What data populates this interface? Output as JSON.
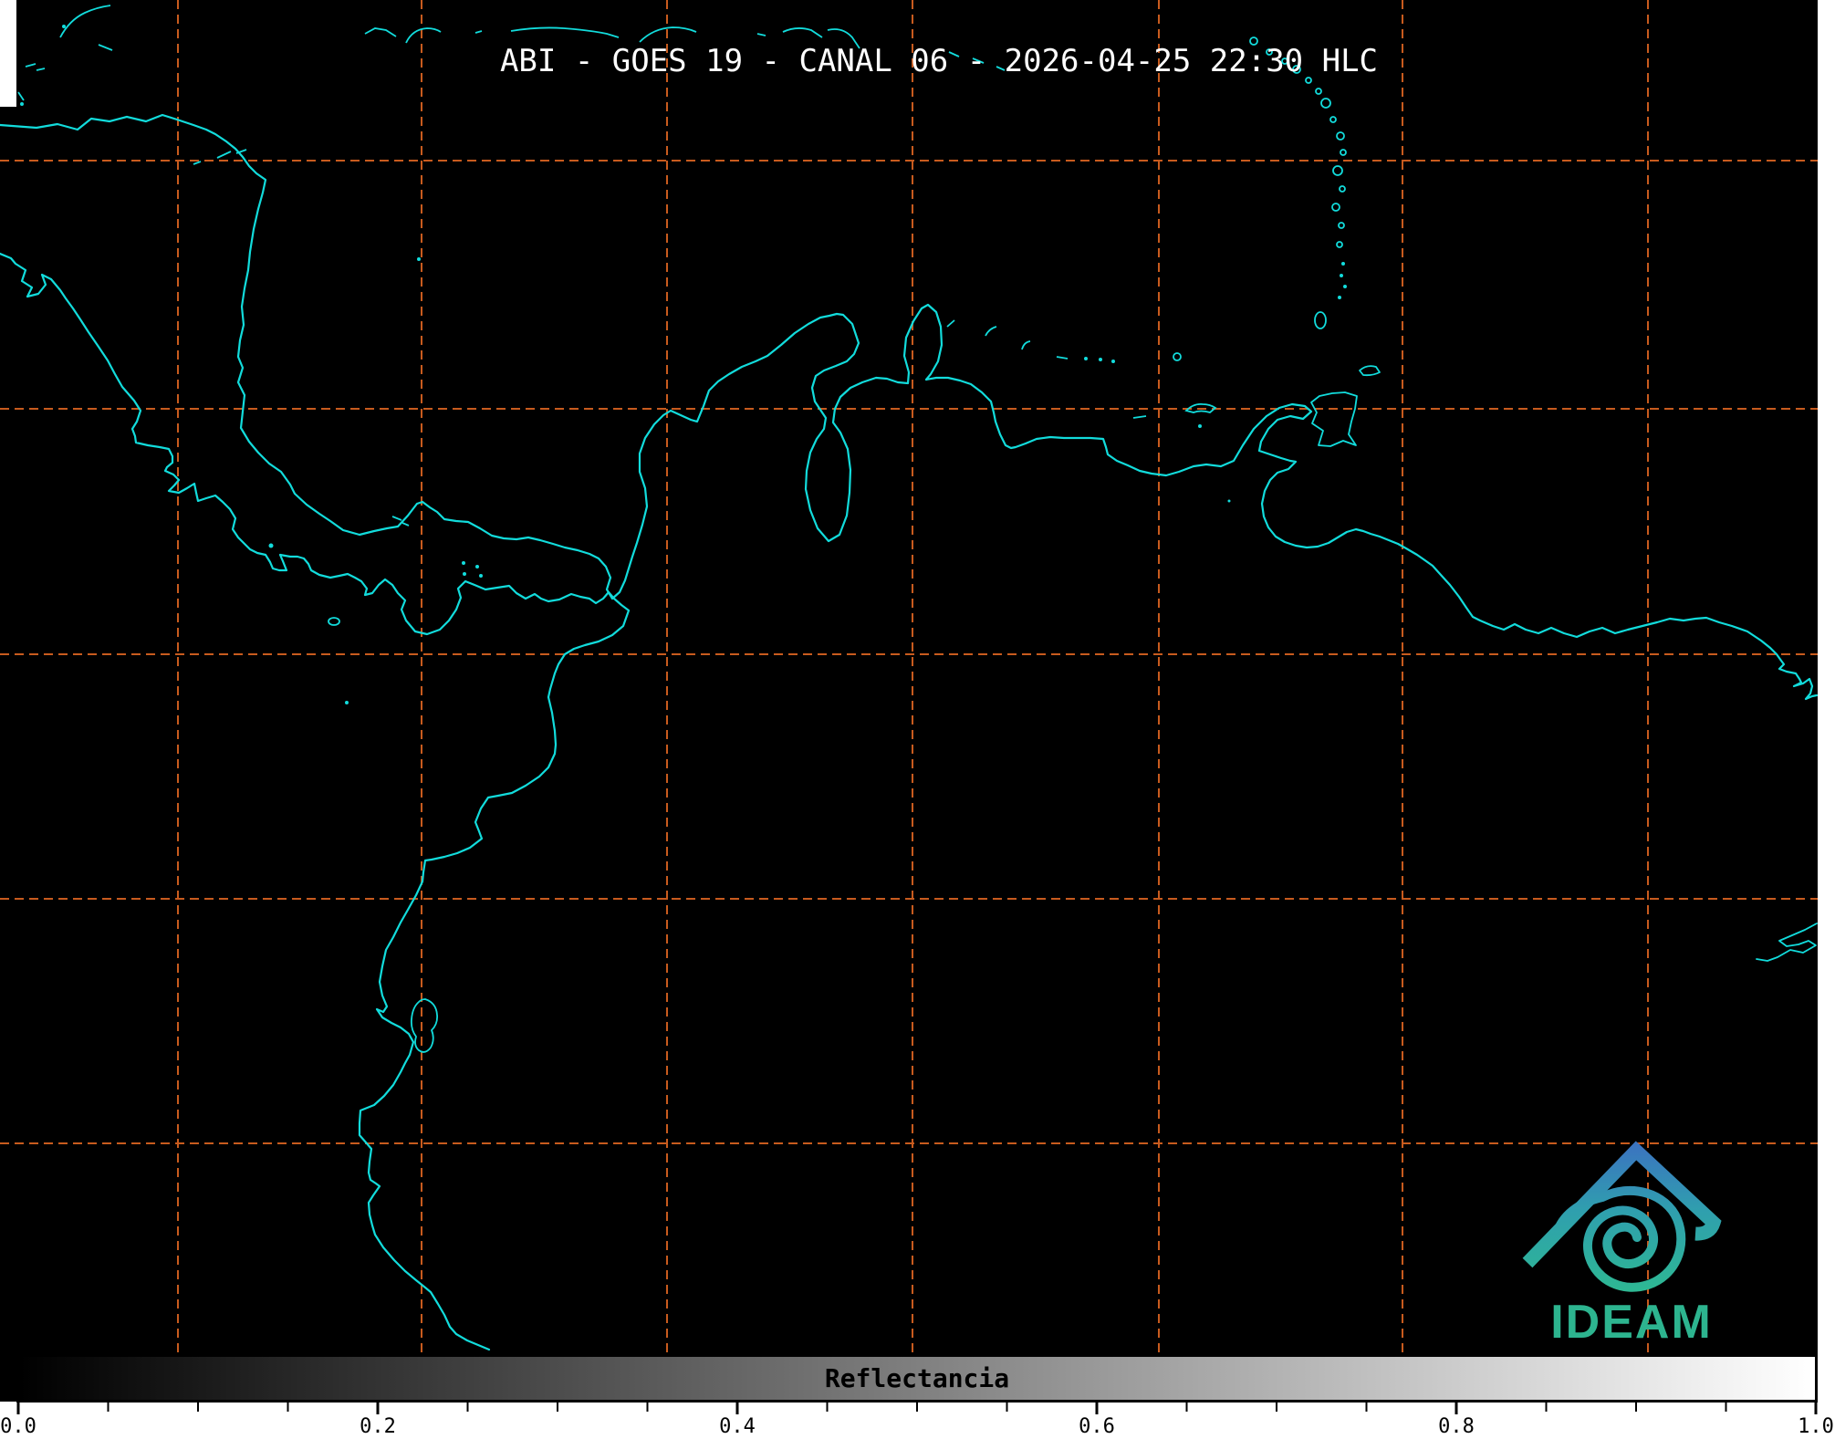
{
  "header": {
    "title": "ABI - GOES 19 - CANAL 06 - 2026-04-25 22:30 HLC"
  },
  "colorbar": {
    "label": "Reflectancia",
    "ticks": [
      "0.0",
      "0.2",
      "0.4",
      "0.6",
      "0.8",
      "1.0"
    ],
    "min": 0.0,
    "max": 1.0,
    "minor_step": 0.05,
    "gradient_start": "#000000",
    "gradient_end": "#ffffff"
  },
  "logo": {
    "text": "IDEAM"
  },
  "colors": {
    "coastline": "#12dcdc",
    "graticule": "#c85b1e",
    "map_background": "#000000",
    "nodata_strip": "#ffffff",
    "title_text": "#ffffff",
    "colorbar_text": "#000000",
    "logo_blue": "#3b74c0",
    "logo_green": "#2eb893",
    "logo_text_color": "#2db48f"
  }
}
